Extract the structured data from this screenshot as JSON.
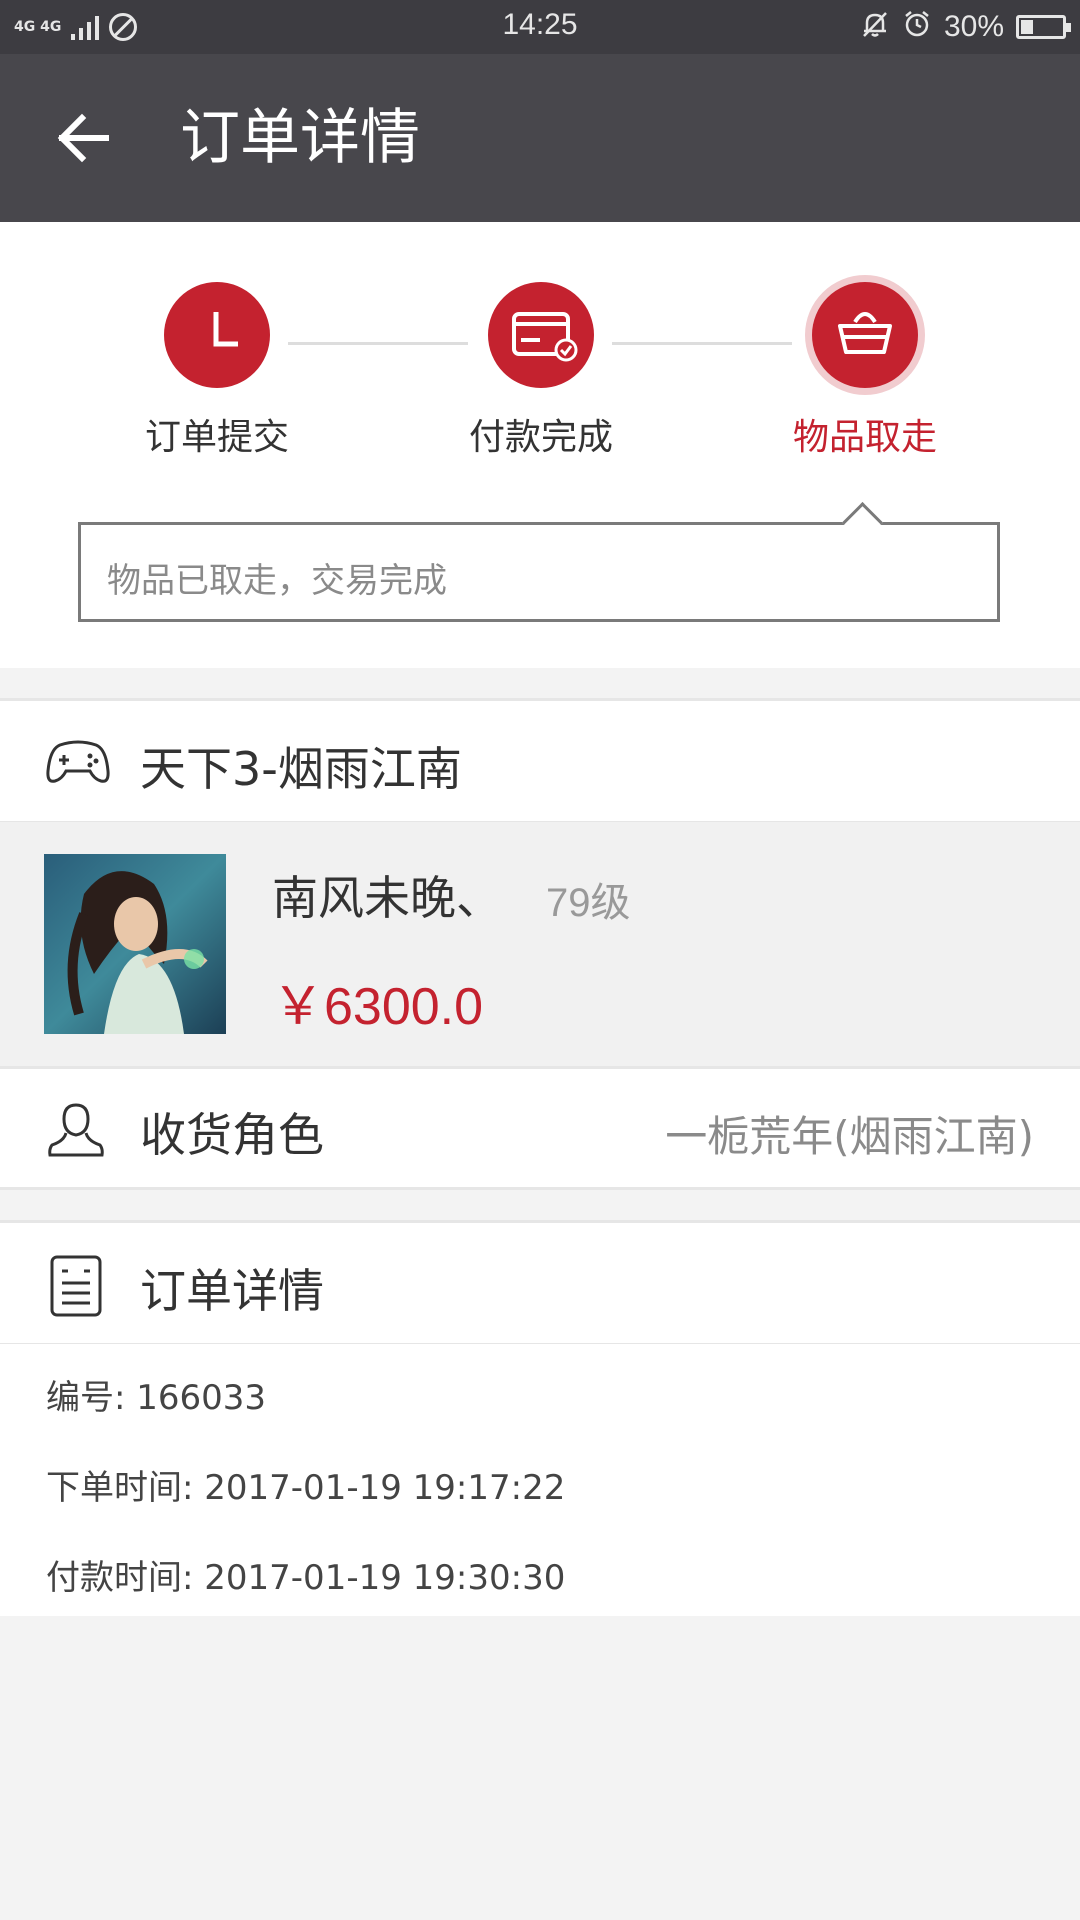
{
  "status_bar": {
    "network": "4G 4G",
    "time": "14:25",
    "battery": "30%",
    "battery_level": 0.3
  },
  "app_bar": {
    "back_icon": "arrow-left-icon",
    "title": "订单详情"
  },
  "steps": [
    {
      "label": "订单提交",
      "icon": "clock-icon",
      "state": "done"
    },
    {
      "label": "付款完成",
      "icon": "credit-card-icon",
      "state": "done"
    },
    {
      "label": "物品取走",
      "icon": "basket-icon",
      "state": "current"
    }
  ],
  "status_message": "物品已取走，交易完成",
  "game": {
    "icon": "gamepad-icon",
    "name": "天下3-烟雨江南"
  },
  "item": {
    "name": "南风未晚、",
    "level": "79级",
    "price": "￥6300.0"
  },
  "receiver": {
    "icon": "user-icon",
    "label": "收货角色",
    "value": "一栀荒年(烟雨江南)"
  },
  "order_details": {
    "icon": "document-icon",
    "title": "订单详情",
    "lines": [
      "编号: 166033",
      "下单时间: 2017-01-19 19:17:22",
      "付款时间: 2017-01-19 19:30:30"
    ]
  },
  "colors": {
    "accent": "#c4222f",
    "app_bar": "#48474c",
    "status_bar": "#3d3c41"
  }
}
